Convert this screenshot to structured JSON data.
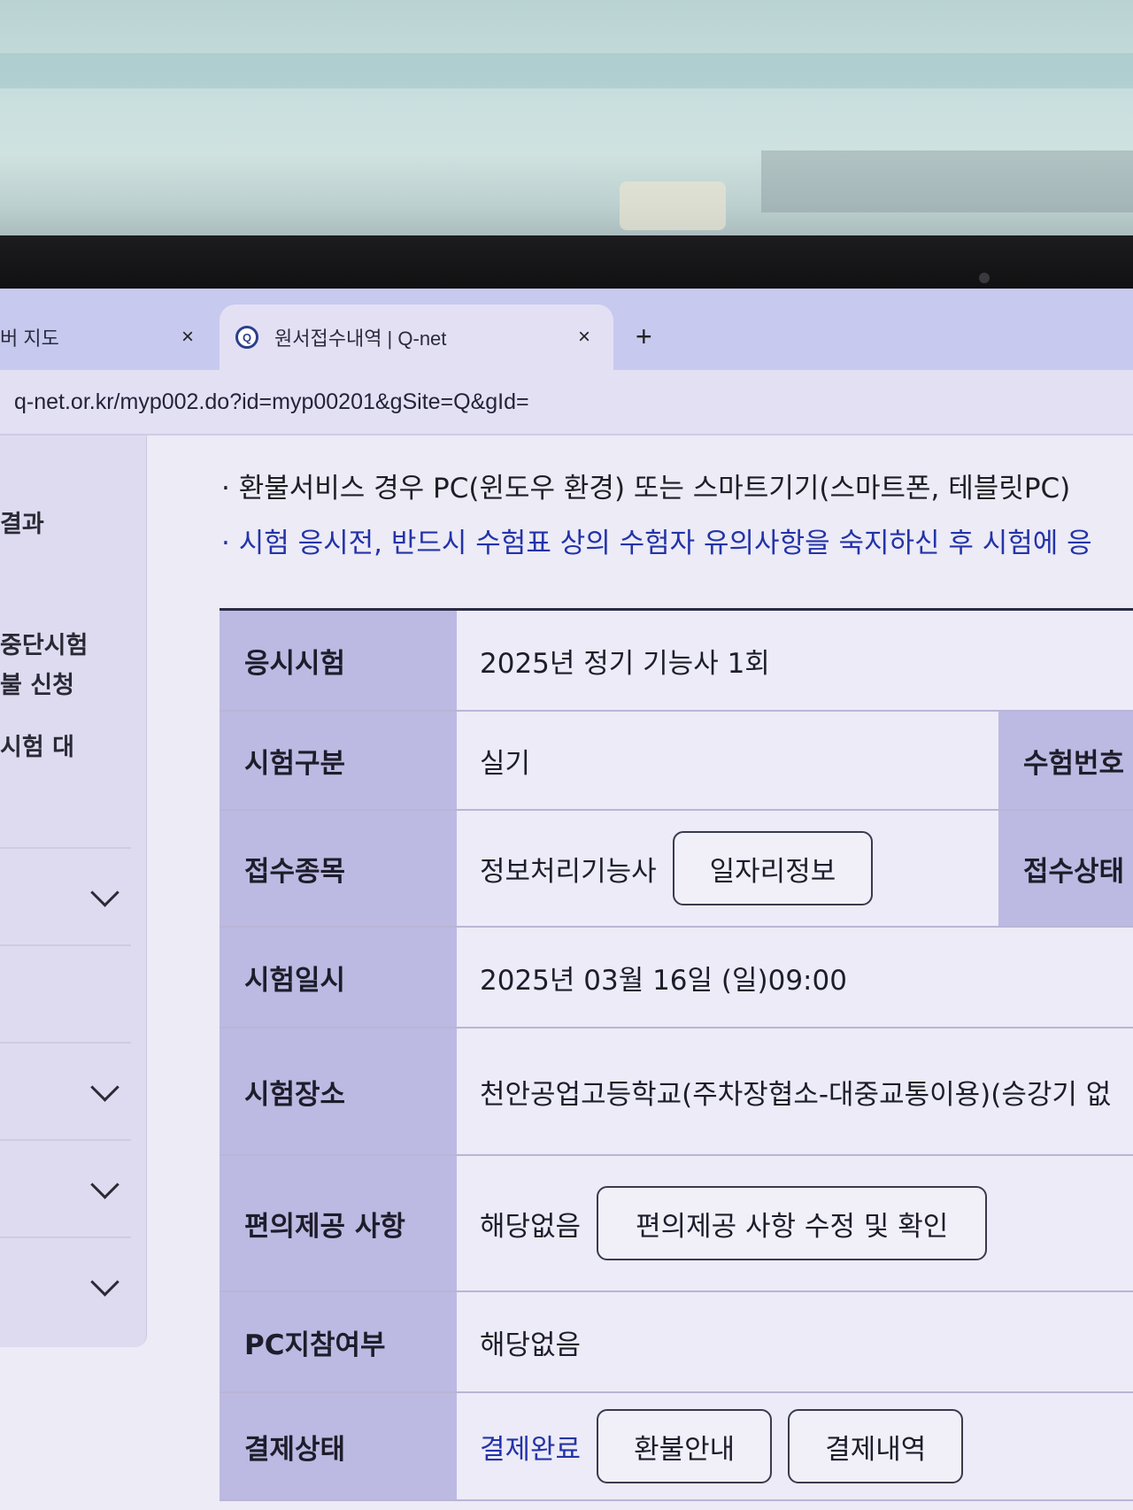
{
  "browser": {
    "tabs": [
      {
        "label": "버 지도",
        "close": "×",
        "active": false
      },
      {
        "label": "원서접수내역 | Q-net",
        "close": "×",
        "active": true,
        "favicon": "Q"
      }
    ],
    "new_tab": "+",
    "url": "q-net.or.kr/myp002.do?id=myp00201&gSite=Q&gId="
  },
  "sidebar": {
    "items": [
      "결과",
      "중단시험",
      "불 신청",
      "시험 대"
    ],
    "menu_icon": "chevron-down-icon"
  },
  "notices": [
    "· 환불서비스 경우 PC(윈도우 환경) 또는 스마트기기(스마트폰, 테블릿PC)",
    "· 시험 응시전, 반드시 수험표 상의 수험자 유의사항을 숙지하신 후 시험에 응"
  ],
  "application": {
    "exam_label": "응시시험",
    "exam_value": "2025년 정기 기능사 1회",
    "type_label": "시험구분",
    "type_value": "실기",
    "number_label": "수험번호",
    "item_label": "접수종목",
    "item_value": "정보처리기능사",
    "job_info_button": "일자리정보",
    "status_label": "접수상태",
    "datetime_label": "시험일시",
    "datetime_value": "2025년 03월 16일 (일)09:00",
    "place_label": "시험장소",
    "place_value": "천안공업고등학교(주차장협소-대중교통이용)(승강기 없",
    "convenience_label": "편의제공 사항",
    "convenience_value": "해당없음",
    "convenience_button": "편의제공 사항 수정 및 확인",
    "pc_label": "PC지참여부",
    "pc_value": "해당없음",
    "payment_label": "결제상태",
    "payment_value": "결제완료",
    "refund_button": "환불안내",
    "payment_detail_button": "결제내역"
  },
  "colors": {
    "header_cell": "#bcb9e2",
    "link_blue": "#2433a8",
    "tabstrip": "#c7c9ee"
  }
}
